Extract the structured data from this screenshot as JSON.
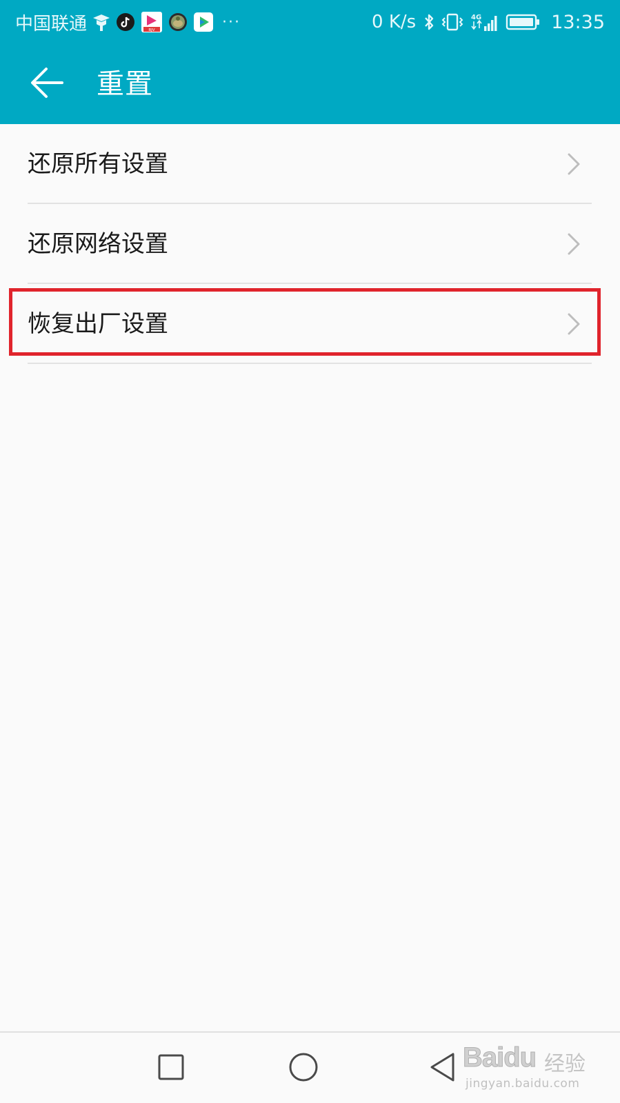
{
  "status_bar": {
    "carrier": "中国联通",
    "notification_icons": [
      "student-cap-icon",
      "tiktok-icon",
      "video-app-icon",
      "turtle-app-icon",
      "video-play-app-icon"
    ],
    "more_indicator": "···",
    "net_speed": "0 K/s",
    "status_icons": [
      "bluetooth-icon",
      "vibrate-icon",
      "signal-4g-icon",
      "battery-icon"
    ],
    "time": "13:35"
  },
  "app_bar": {
    "title": "重置",
    "back_icon": "arrow-left-icon"
  },
  "list": {
    "items": [
      {
        "label": "还原所有设置",
        "icon": "chevron-right-icon"
      },
      {
        "label": "还原网络设置",
        "icon": "chevron-right-icon"
      },
      {
        "label": "恢复出厂设置",
        "icon": "chevron-right-icon",
        "highlighted": true
      }
    ]
  },
  "nav_bar": {
    "buttons": [
      "recent-apps-icon",
      "home-icon",
      "back-triangle-icon"
    ]
  },
  "watermark": {
    "logo": "Baidu",
    "label": "经验",
    "url": "jingyan.baidu.com"
  },
  "colors": {
    "primary": "#00a9c3",
    "background": "#fafafa",
    "highlight": "#e0242c",
    "text": "#1a1a1a"
  }
}
